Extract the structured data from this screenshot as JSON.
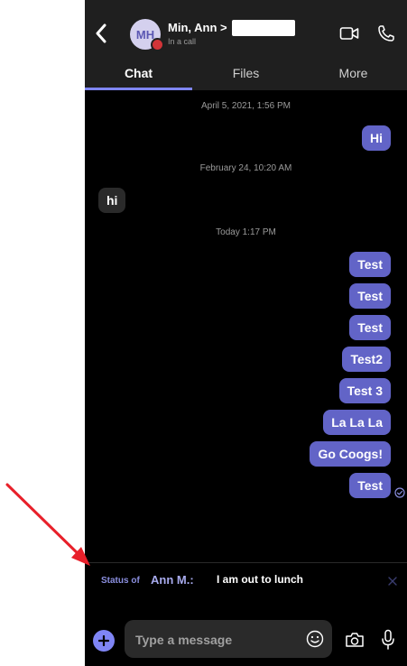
{
  "header": {
    "avatar_initials": "MH",
    "contact_name": "Min, Ann >",
    "contact_status": "In a call",
    "presence_color": "#d13438"
  },
  "tabs": [
    {
      "label": "Chat",
      "active": true
    },
    {
      "label": "Files",
      "active": false
    },
    {
      "label": "More",
      "active": false
    }
  ],
  "messages": {
    "ts1": "April 5, 2021, 1:56 PM",
    "m1": "Hi",
    "ts2": "February 24, 10:20 AM",
    "m2": "hi",
    "ts3": "Today 1:17 PM",
    "m3": "Test",
    "m4": "Test",
    "m5": "Test",
    "m6": "Test2",
    "m7": "Test 3",
    "m8": "La La La",
    "m9": "Go Coogs!",
    "m10": "Test"
  },
  "status_banner": {
    "prefix": "Status of",
    "name": "Ann M.:",
    "message": "I am out to lunch"
  },
  "composer": {
    "placeholder": "Type a message"
  },
  "colors": {
    "accent": "#7f85f5",
    "sent_bubble": "#6264c7",
    "received_bubble": "#2a2a2a",
    "background": "#000000",
    "annotation_arrow": "#e8202a"
  },
  "icons": {
    "back": "chevron-left-icon",
    "video": "video-camera-icon",
    "call": "phone-icon",
    "read_receipt": "check-circle-icon",
    "close": "close-icon",
    "add": "plus-icon",
    "emoji": "emoji-icon",
    "camera": "camera-icon",
    "mic": "microphone-icon"
  }
}
